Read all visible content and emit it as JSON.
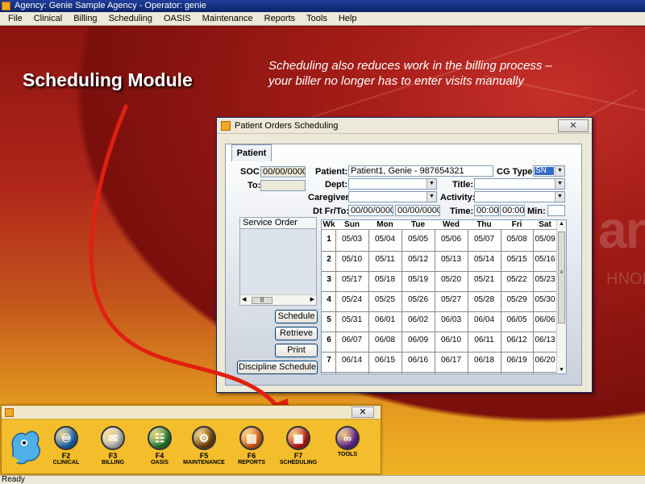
{
  "window": {
    "title": "Agency: Genie Sample Agency - Operator: genie"
  },
  "menu": [
    "File",
    "Clinical",
    "Billing",
    "Scheduling",
    "OASIS",
    "Maintenance",
    "Reports",
    "Tools",
    "Help"
  ],
  "slide": {
    "title": "Scheduling Module",
    "caption_line1": "Scheduling also reduces work in the billing process –",
    "caption_line2": "your biller no longer has to enter visits manually",
    "watermark_big": "an",
    "watermark_small": "HNOLO"
  },
  "dialog": {
    "title": "Patient Orders Scheduling",
    "close_icon": "x-icon",
    "tab": "Patient",
    "soc_label": "SOC:",
    "soc_value": "00/00/0000",
    "to_label": "To:",
    "to_value": "",
    "patient_label": "Patient:",
    "patient_value": "Patient1, Genie  - 987654321",
    "cgtype_label": "CG Type:",
    "cgtype_value": "SN",
    "dept_label": "Dept:",
    "dept_value": "",
    "title_label": "Title:",
    "title_value": "",
    "caregiver_label": "Caregiver:",
    "caregiver_value": "",
    "activity_label": "Activity:",
    "activity_value": "",
    "dtfrto_label": "Dt Fr/To:",
    "dt_from": "00/00/0000",
    "dt_to": "00/00/0000",
    "time_label": "Time:",
    "time_from": "00:00",
    "time_to": "00:00",
    "min_label": "Min:",
    "min_value": "",
    "service_order_label": "Service Order",
    "buttons": {
      "schedule": "Schedule",
      "retrieve": "Retrieve",
      "print": "Print",
      "discipline": "Discipline Schedule"
    },
    "calendar": {
      "headers": [
        "Wk",
        "Sun",
        "Mon",
        "Tue",
        "Wed",
        "Thu",
        "Fri",
        "Sat"
      ],
      "rows": [
        [
          "1",
          "05/03",
          "05/04",
          "05/05",
          "05/06",
          "05/07",
          "05/08",
          "05/09"
        ],
        [
          "2",
          "05/10",
          "05/11",
          "05/12",
          "05/13",
          "05/14",
          "05/15",
          "05/16"
        ],
        [
          "3",
          "05/17",
          "05/18",
          "05/19",
          "05/20",
          "05/21",
          "05/22",
          "05/23"
        ],
        [
          "4",
          "05/24",
          "05/25",
          "05/26",
          "05/27",
          "05/28",
          "05/29",
          "05/30"
        ],
        [
          "5",
          "05/31",
          "06/01",
          "06/02",
          "06/03",
          "06/04",
          "06/05",
          "06/06"
        ],
        [
          "6",
          "06/07",
          "06/08",
          "06/09",
          "06/10",
          "06/11",
          "06/12",
          "06/13"
        ],
        [
          "7",
          "06/14",
          "06/15",
          "06/16",
          "06/17",
          "06/18",
          "06/19",
          "06/20"
        ]
      ]
    }
  },
  "toolbar": {
    "close_icon": "x-icon",
    "buttons": [
      {
        "key": "F2",
        "name": "CLINICAL",
        "icon": "stethoscope-icon",
        "color": "#1f6fc5"
      },
      {
        "key": "F3",
        "name": "BILLING",
        "icon": "billing-icon",
        "color": "#c9c9c9"
      },
      {
        "key": "F4",
        "name": "OASIS",
        "icon": "clipboard-icon",
        "color": "#2a8a3a"
      },
      {
        "key": "F5",
        "name": "MAINTENANCE",
        "icon": "gears-icon",
        "color": "#7a4a12"
      },
      {
        "key": "F6",
        "name": "REPORTS",
        "icon": "reports-icon",
        "color": "#e06a1a"
      },
      {
        "key": "F7",
        "name": "SCHEDULING",
        "icon": "calendar-icon",
        "color": "#c81e1e"
      },
      {
        "key": "",
        "name": "TOOLS",
        "icon": "paperclip-icon",
        "color": "#6a2a9a"
      }
    ]
  },
  "status": {
    "text": "Ready"
  }
}
